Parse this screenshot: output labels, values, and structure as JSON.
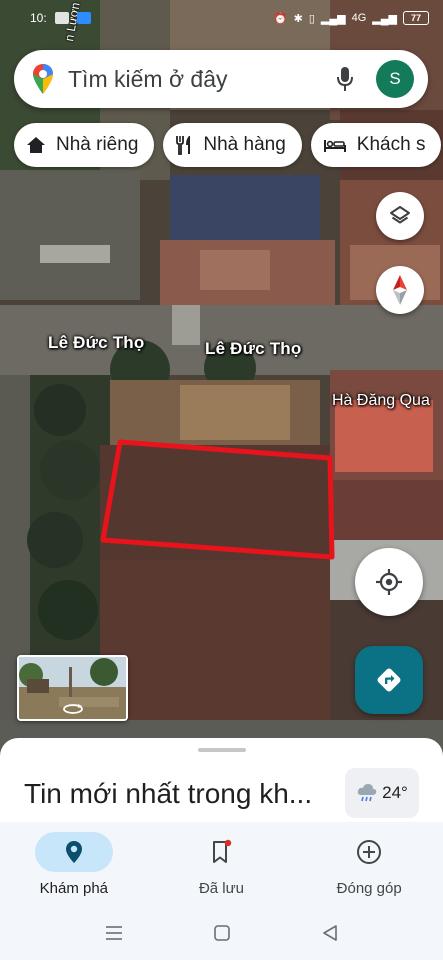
{
  "status_bar": {
    "time": "10:",
    "network": "4G",
    "battery": "77"
  },
  "search": {
    "placeholder": "Tìm kiếm ở đây",
    "avatar_letter": "S"
  },
  "chips": [
    {
      "label": "Nhà riêng",
      "icon": "home-icon"
    },
    {
      "label": "Nhà hàng",
      "icon": "restaurant-icon"
    },
    {
      "label": "Khách s",
      "icon": "hotel-icon"
    }
  ],
  "map": {
    "road_labels": [
      "Lê Đức Thọ",
      "Lê Đức Thọ"
    ],
    "poi_label": "Hà Đăng Qua",
    "vertical_road_label": "n Lươn",
    "highlight_color": "#e8131b"
  },
  "sheet": {
    "title": "Tin mới nhất trong kh...",
    "temperature": "24°"
  },
  "bottom_nav": [
    {
      "label": "Khám phá",
      "icon": "explore-pin-icon",
      "active": true
    },
    {
      "label": "Đã lưu",
      "icon": "bookmark-icon",
      "active": false
    },
    {
      "label": "Đóng góp",
      "icon": "add-circle-icon",
      "active": false
    }
  ],
  "colors": {
    "accent": "#0b7285",
    "active_nav": "#c8e6f9",
    "avatar": "#137a5a"
  }
}
